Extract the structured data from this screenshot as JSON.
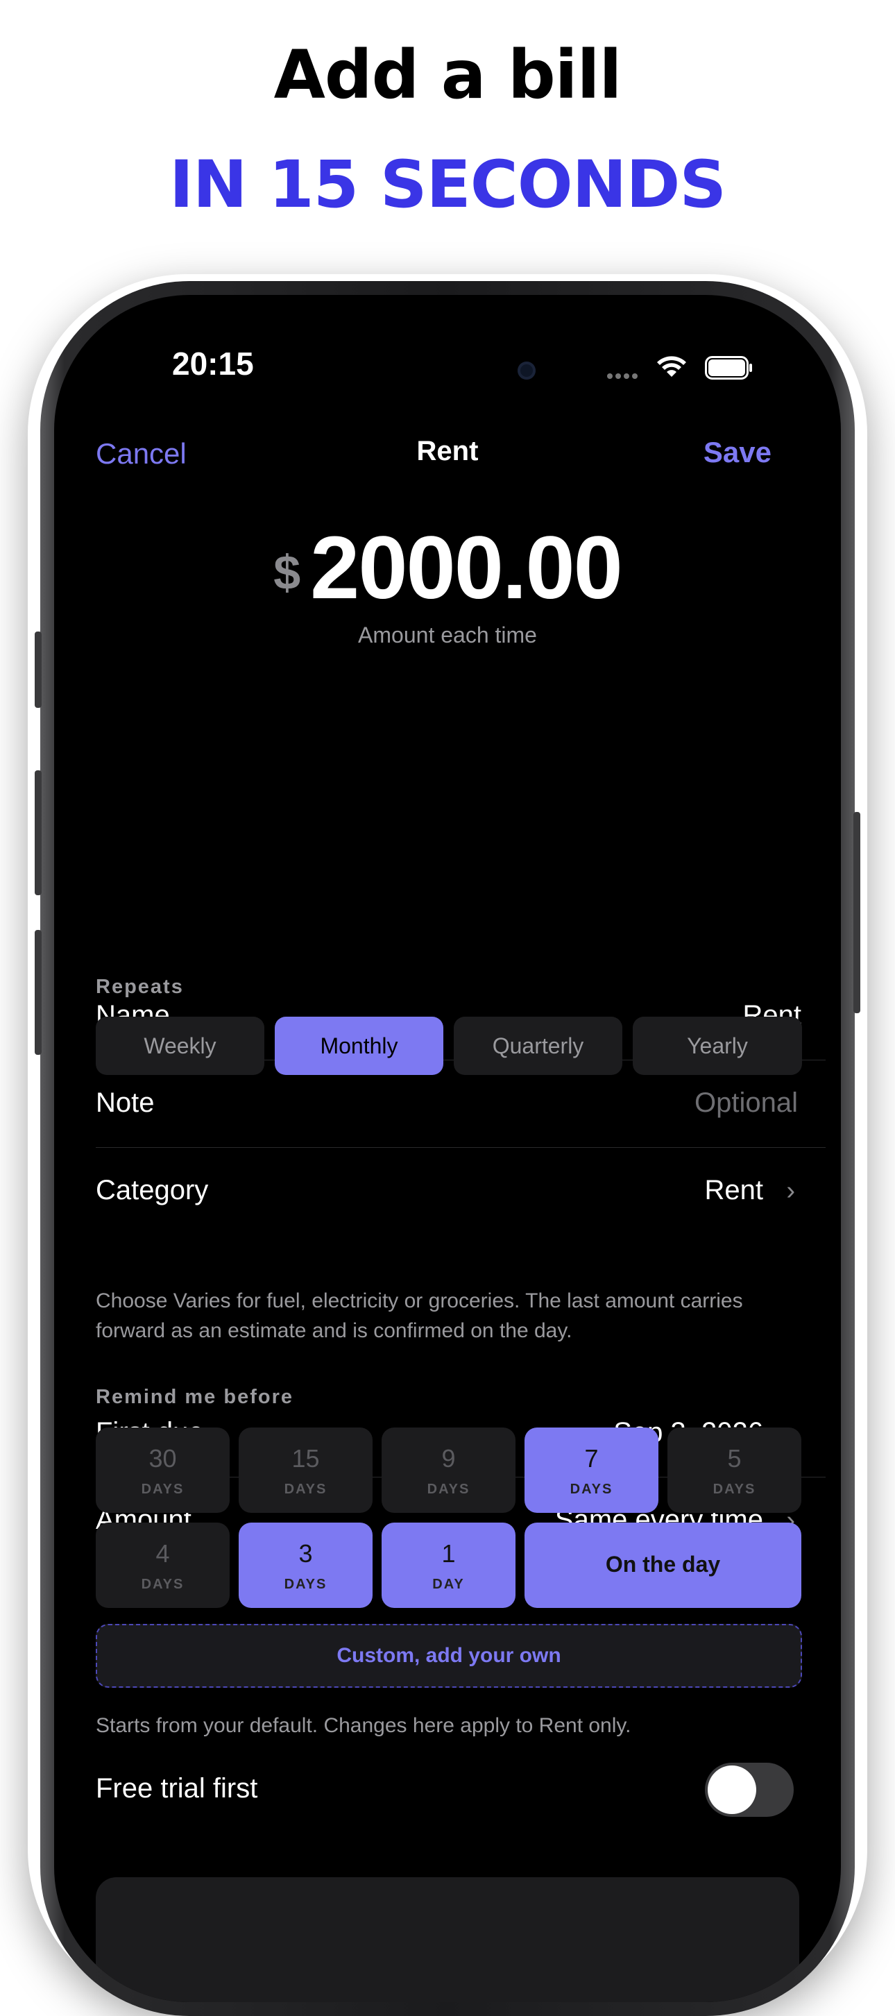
{
  "promo": {
    "headline": "Add a bill",
    "subheadline": "IN 15 SECONDS",
    "accent_color": "#3a35e6"
  },
  "status_bar": {
    "time": "20:15"
  },
  "nav": {
    "cancel_label": "Cancel",
    "title": "Rent",
    "save_label": "Save"
  },
  "amount": {
    "currency": "$",
    "value": "2000.00",
    "caption": "Amount each time"
  },
  "fields": {
    "name": {
      "label": "Name",
      "value": "Rent"
    },
    "note": {
      "label": "Note",
      "placeholder": "Optional"
    },
    "category": {
      "label": "Category",
      "value": "Rent"
    }
  },
  "repeats": {
    "title": "Repeats",
    "options": [
      "Weekly",
      "Monthly",
      "Quarterly",
      "Yearly"
    ],
    "selected": "Monthly"
  },
  "schedule": {
    "first_due": {
      "label": "First due",
      "value": "Sep 3, 2026"
    },
    "amount_mode": {
      "label": "Amount",
      "value": "Same every time"
    },
    "helper": "Choose Varies for fuel, electricity or groceries. The last amount carries forward as an estimate and is confirmed on the day."
  },
  "reminders": {
    "title": "Remind me before",
    "options": [
      {
        "num": "30",
        "unit": "DAYS",
        "selected": false
      },
      {
        "num": "15",
        "unit": "DAYS",
        "selected": false
      },
      {
        "num": "9",
        "unit": "DAYS",
        "selected": false
      },
      {
        "num": "7",
        "unit": "DAYS",
        "selected": true
      },
      {
        "num": "5",
        "unit": "DAYS",
        "selected": false
      },
      {
        "num": "4",
        "unit": "DAYS",
        "selected": false
      },
      {
        "num": "3",
        "unit": "DAYS",
        "selected": true
      },
      {
        "num": "1",
        "unit": "DAY",
        "selected": true
      }
    ],
    "on_the_day": {
      "label": "On the day",
      "selected": true
    },
    "custom_label": "Custom, add your own",
    "helper": "Starts from your default. Changes here apply to Rent only."
  },
  "free_trial": {
    "label": "Free trial first",
    "enabled": false
  },
  "colors": {
    "accent": "#7d79f2",
    "background": "#000000",
    "cell": "#1c1c1e"
  }
}
